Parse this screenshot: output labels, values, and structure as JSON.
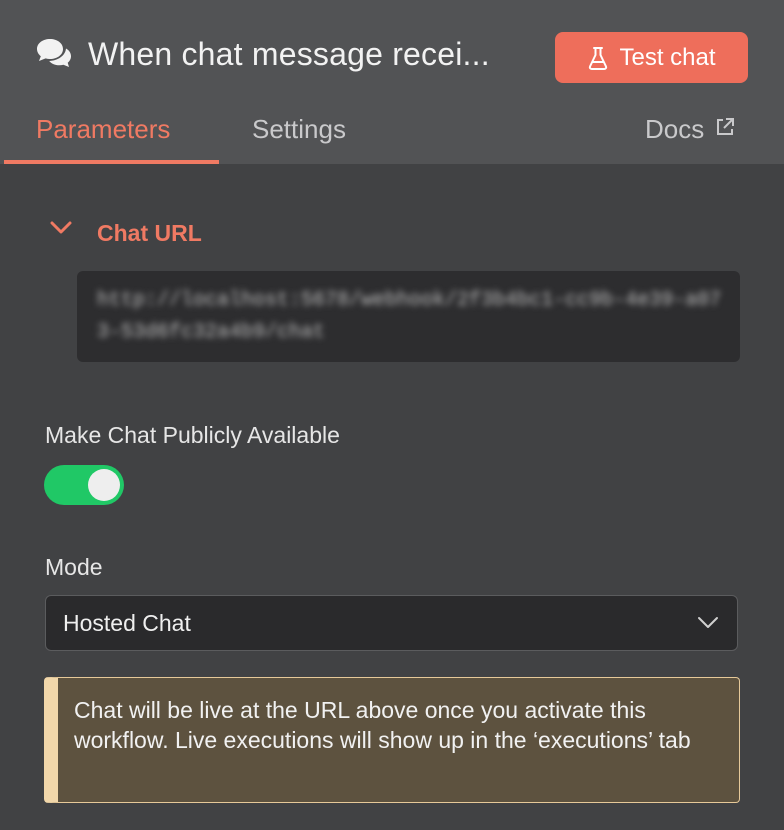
{
  "header": {
    "title": "When chat message recei...",
    "test_button_label": "Test chat"
  },
  "tabs": [
    {
      "label": "Parameters",
      "active": true
    },
    {
      "label": "Settings",
      "active": false
    }
  ],
  "docs_label": "Docs",
  "chat_url_section": {
    "title": "Chat URL",
    "url": "http://localhost:5678/webhook/2f3b4bc1-cc9b-4e39-a073-53d6fc32a4b9/chat"
  },
  "public_field": {
    "label": "Make Chat Publicly Available",
    "enabled": true
  },
  "mode_field": {
    "label": "Mode",
    "value": "Hosted Chat"
  },
  "notice": {
    "text": "Chat will be live at the URL above once you activate this workflow. Live executions will show up in the ‘executions’ tab"
  },
  "colors": {
    "accent": "#f07a63",
    "button": "#ee6e5b",
    "toggle_on": "#20c866",
    "notice_bg": "#5d523f",
    "notice_border": "#f1d7aa"
  }
}
